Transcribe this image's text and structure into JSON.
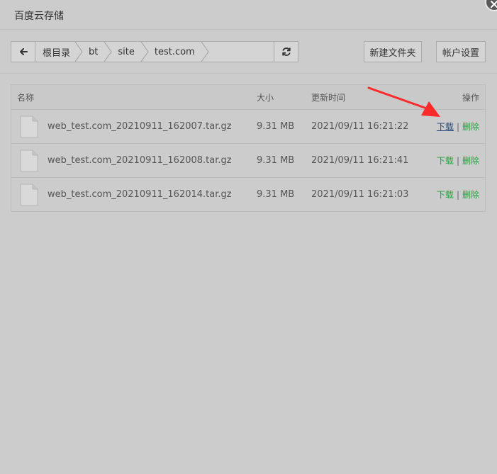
{
  "window": {
    "title": "百度云存储",
    "close_icon": "close-icon"
  },
  "toolbar": {
    "back_icon": "arrow-left-icon",
    "refresh_icon": "refresh-icon",
    "breadcrumbs": [
      "根目录",
      "bt",
      "site",
      "test.com"
    ],
    "new_folder_label": "新建文件夹",
    "account_settings_label": "帐户设置"
  },
  "table": {
    "headers": {
      "name": "名称",
      "size": "大小",
      "updated": "更新时间",
      "actions": "操作"
    },
    "rows": [
      {
        "name": "web_test.com_20210911_162007.tar.gz",
        "size": "9.31 MB",
        "updated": "2021/09/11 16:21:22",
        "download": "下载",
        "sep": "|",
        "delete": "删除"
      },
      {
        "name": "web_test.com_20210911_162008.tar.gz",
        "size": "9.31 MB",
        "updated": "2021/09/11 16:21:41",
        "download": "下载",
        "sep": "|",
        "delete": "删除"
      },
      {
        "name": "web_test.com_20210911_162014.tar.gz",
        "size": "9.31 MB",
        "updated": "2021/09/11 16:21:03",
        "download": "下载",
        "sep": "|",
        "delete": "删除"
      }
    ]
  },
  "colors": {
    "background": "#cccccc",
    "action_green": "#20a53a",
    "annotation_arrow": "#ff2b2b"
  }
}
